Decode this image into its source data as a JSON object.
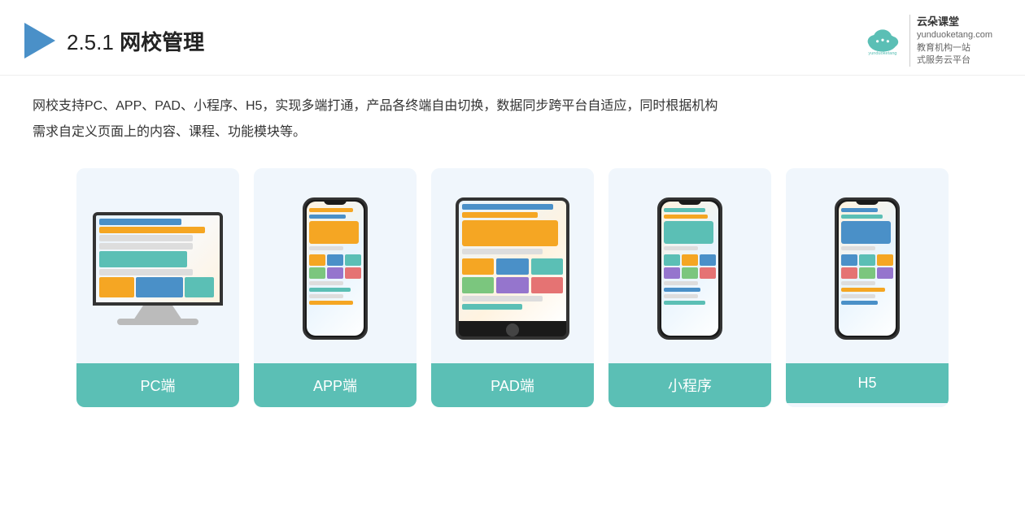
{
  "header": {
    "section_number": "2.5.1",
    "title": "网校管理",
    "brand": {
      "name": "云朵课堂",
      "name_en": "yunduoketang.com",
      "slogan_line1": "教育机构一站",
      "slogan_line2": "式服务云平台"
    }
  },
  "description": {
    "line1": "网校支持PC、APP、PAD、小程序、H5，实现多端打通，产品各终端自由切换，数据同步跨平台自适应，同时根据机构",
    "line2": "需求自定义页面上的内容、课程、功能模块等。"
  },
  "cards": [
    {
      "id": "pc",
      "label": "PC端",
      "type": "pc"
    },
    {
      "id": "app",
      "label": "APP端",
      "type": "phone"
    },
    {
      "id": "pad",
      "label": "PAD端",
      "type": "tablet"
    },
    {
      "id": "miniprogram",
      "label": "小程序",
      "type": "phone"
    },
    {
      "id": "h5",
      "label": "H5",
      "type": "phone"
    }
  ]
}
